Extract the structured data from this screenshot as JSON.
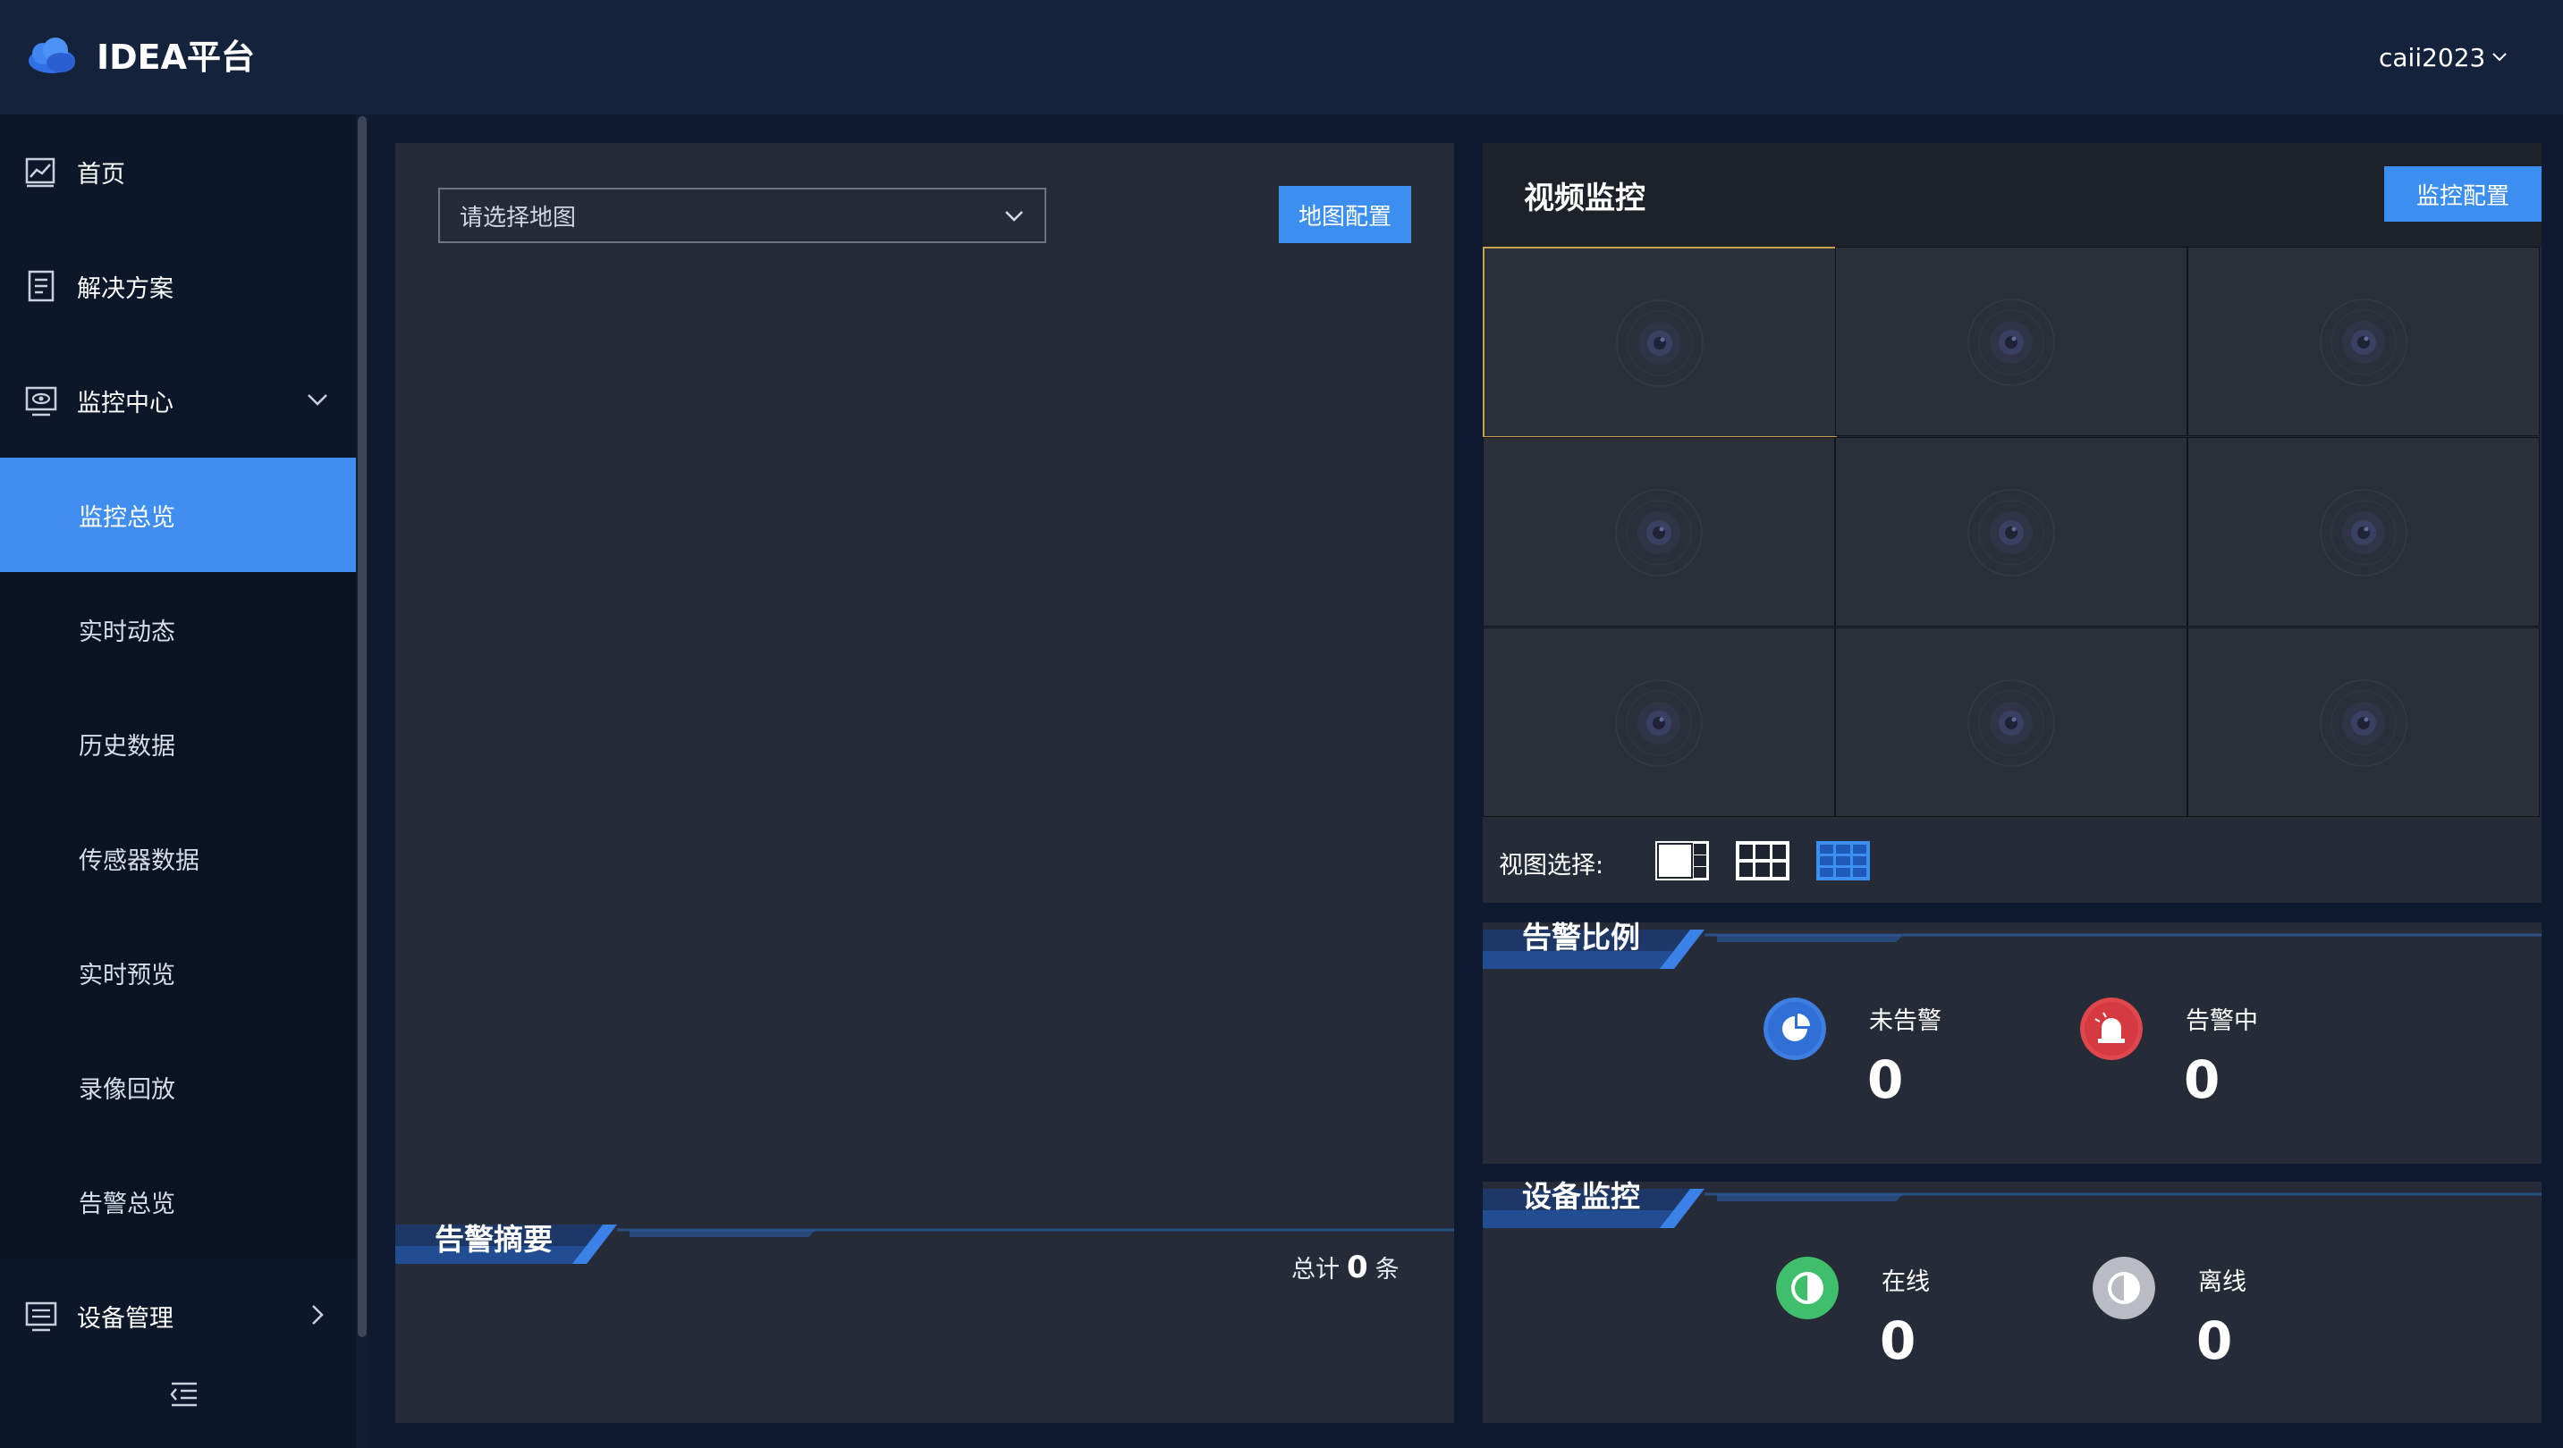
{
  "header": {
    "app_title": "IDEA平台",
    "user_name": "caii2023"
  },
  "sidebar": {
    "home": "首页",
    "solutions": "解决方案",
    "monitor_center": "监控中心",
    "monitor_items": [
      "监控总览",
      "实时动态",
      "历史数据",
      "传感器数据",
      "实时预览",
      "录像回放",
      "告警总览"
    ],
    "device_mgmt": "设备管理"
  },
  "map_panel": {
    "select_placeholder": "请选择地图",
    "config_button": "地图配置",
    "alarm_summary_title": "告警摘要",
    "total_prefix": "总计",
    "total_count": "0",
    "total_suffix": "条"
  },
  "video_panel": {
    "title": "视频监控",
    "config_button": "监控配置",
    "view_select_label": "视图选择:",
    "active_layout": "3x3",
    "selected_cell": 1
  },
  "alarm_ratio": {
    "title": "告警比例",
    "no_alarm_label": "未告警",
    "no_alarm_value": "0",
    "alarming_label": "告警中",
    "alarming_value": "0"
  },
  "device_monitor": {
    "title": "设备监控",
    "online_label": "在线",
    "online_value": "0",
    "offline_label": "离线",
    "offline_value": "0"
  },
  "colors": {
    "accent": "#3f8ef0",
    "online": "#3fbf6b",
    "offline": "#b9bcc2",
    "alarm": "#e0474c",
    "selected_cell_border": "#c8a24a"
  }
}
